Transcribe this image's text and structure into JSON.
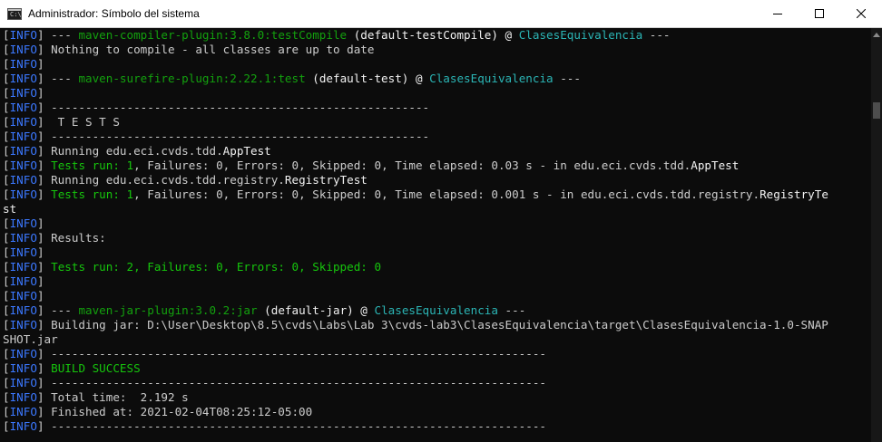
{
  "window": {
    "title": "Administrador: Símbolo del sistema",
    "icon_glyph": "C:\\"
  },
  "lines": [
    [
      {
        "t": "[",
        "c": "default"
      },
      {
        "t": "INFO",
        "c": "lvl"
      },
      {
        "t": "] --- ",
        "c": "default"
      },
      {
        "t": "maven-compiler-plugin:3.8.0:testCompile",
        "c": "plugin"
      },
      {
        "t": " (default-testCompile) @ ",
        "c": "white"
      },
      {
        "t": "ClasesEquivalencia",
        "c": "teal"
      },
      {
        "t": " ---",
        "c": "default"
      }
    ],
    [
      {
        "t": "[",
        "c": "default"
      },
      {
        "t": "INFO",
        "c": "lvl"
      },
      {
        "t": "] Nothing to compile - all classes are up to date",
        "c": "default"
      }
    ],
    [
      {
        "t": "[",
        "c": "default"
      },
      {
        "t": "INFO",
        "c": "lvl"
      },
      {
        "t": "]",
        "c": "default"
      }
    ],
    [
      {
        "t": "[",
        "c": "default"
      },
      {
        "t": "INFO",
        "c": "lvl"
      },
      {
        "t": "] --- ",
        "c": "default"
      },
      {
        "t": "maven-surefire-plugin:2.22.1:test",
        "c": "plugin"
      },
      {
        "t": " (default-test) @ ",
        "c": "white"
      },
      {
        "t": "ClasesEquivalencia",
        "c": "teal"
      },
      {
        "t": " ---",
        "c": "default"
      }
    ],
    [
      {
        "t": "[",
        "c": "default"
      },
      {
        "t": "INFO",
        "c": "lvl"
      },
      {
        "t": "]",
        "c": "default"
      }
    ],
    [
      {
        "t": "[",
        "c": "default"
      },
      {
        "t": "INFO",
        "c": "lvl"
      },
      {
        "t": "] -------------------------------------------------------",
        "c": "default"
      }
    ],
    [
      {
        "t": "[",
        "c": "default"
      },
      {
        "t": "INFO",
        "c": "lvl"
      },
      {
        "t": "]  T E S T S",
        "c": "default"
      }
    ],
    [
      {
        "t": "[",
        "c": "default"
      },
      {
        "t": "INFO",
        "c": "lvl"
      },
      {
        "t": "] -------------------------------------------------------",
        "c": "default"
      }
    ],
    [
      {
        "t": "[",
        "c": "default"
      },
      {
        "t": "INFO",
        "c": "lvl"
      },
      {
        "t": "] Running edu.eci.cvds.tdd.",
        "c": "default"
      },
      {
        "t": "AppTest",
        "c": "white"
      }
    ],
    [
      {
        "t": "[",
        "c": "default"
      },
      {
        "t": "INFO",
        "c": "lvl"
      },
      {
        "t": "] ",
        "c": "default"
      },
      {
        "t": "Tests run: ",
        "c": "green"
      },
      {
        "t": "1",
        "c": "green"
      },
      {
        "t": ", Failures: 0, Errors: 0, Skipped: 0, Time elapsed: 0.03 s - in edu.eci.cvds.tdd.",
        "c": "default"
      },
      {
        "t": "AppTest",
        "c": "white"
      }
    ],
    [
      {
        "t": "[",
        "c": "default"
      },
      {
        "t": "INFO",
        "c": "lvl"
      },
      {
        "t": "] Running edu.eci.cvds.tdd.registry.",
        "c": "default"
      },
      {
        "t": "RegistryTest",
        "c": "white"
      }
    ],
    [
      {
        "t": "[",
        "c": "default"
      },
      {
        "t": "INFO",
        "c": "lvl"
      },
      {
        "t": "] ",
        "c": "default"
      },
      {
        "t": "Tests run: ",
        "c": "green"
      },
      {
        "t": "1",
        "c": "green"
      },
      {
        "t": ", Failures: 0, Errors: 0, Skipped: 0, Time elapsed: 0.001 s - in edu.eci.cvds.tdd.registry.",
        "c": "default"
      },
      {
        "t": "RegistryTe",
        "c": "white"
      }
    ],
    [
      {
        "t": "st",
        "c": "white"
      }
    ],
    [
      {
        "t": "[",
        "c": "default"
      },
      {
        "t": "INFO",
        "c": "lvl"
      },
      {
        "t": "]",
        "c": "default"
      }
    ],
    [
      {
        "t": "[",
        "c": "default"
      },
      {
        "t": "INFO",
        "c": "lvl"
      },
      {
        "t": "] Results:",
        "c": "default"
      }
    ],
    [
      {
        "t": "[",
        "c": "default"
      },
      {
        "t": "INFO",
        "c": "lvl"
      },
      {
        "t": "]",
        "c": "default"
      }
    ],
    [
      {
        "t": "[",
        "c": "default"
      },
      {
        "t": "INFO",
        "c": "lvl"
      },
      {
        "t": "] ",
        "c": "default"
      },
      {
        "t": "Tests run: 2, Failures: 0, Errors: 0, Skipped: 0",
        "c": "green"
      }
    ],
    [
      {
        "t": "[",
        "c": "default"
      },
      {
        "t": "INFO",
        "c": "lvl"
      },
      {
        "t": "]",
        "c": "default"
      }
    ],
    [
      {
        "t": "[",
        "c": "default"
      },
      {
        "t": "INFO",
        "c": "lvl"
      },
      {
        "t": "]",
        "c": "default"
      }
    ],
    [
      {
        "t": "[",
        "c": "default"
      },
      {
        "t": "INFO",
        "c": "lvl"
      },
      {
        "t": "] --- ",
        "c": "default"
      },
      {
        "t": "maven-jar-plugin:3.0.2:jar",
        "c": "plugin"
      },
      {
        "t": " (default-jar) @ ",
        "c": "white"
      },
      {
        "t": "ClasesEquivalencia",
        "c": "teal"
      },
      {
        "t": " ---",
        "c": "default"
      }
    ],
    [
      {
        "t": "[",
        "c": "default"
      },
      {
        "t": "INFO",
        "c": "lvl"
      },
      {
        "t": "] Building jar: D:\\User\\Desktop\\8.5\\cvds\\Labs\\Lab 3\\cvds-lab3\\ClasesEquivalencia\\target\\ClasesEquivalencia-1.0-SNAP",
        "c": "default"
      }
    ],
    [
      {
        "t": "SHOT.jar",
        "c": "default"
      }
    ],
    [
      {
        "t": "[",
        "c": "default"
      },
      {
        "t": "INFO",
        "c": "lvl"
      },
      {
        "t": "] ------------------------------------------------------------------------",
        "c": "default"
      }
    ],
    [
      {
        "t": "[",
        "c": "default"
      },
      {
        "t": "INFO",
        "c": "lvl"
      },
      {
        "t": "] ",
        "c": "default"
      },
      {
        "t": "BUILD SUCCESS",
        "c": "green"
      }
    ],
    [
      {
        "t": "[",
        "c": "default"
      },
      {
        "t": "INFO",
        "c": "lvl"
      },
      {
        "t": "] ------------------------------------------------------------------------",
        "c": "default"
      }
    ],
    [
      {
        "t": "[",
        "c": "default"
      },
      {
        "t": "INFO",
        "c": "lvl"
      },
      {
        "t": "] Total time:  2.192 s",
        "c": "default"
      }
    ],
    [
      {
        "t": "[",
        "c": "default"
      },
      {
        "t": "INFO",
        "c": "lvl"
      },
      {
        "t": "] Finished at: 2021-02-04T08:25:12-05:00",
        "c": "default"
      }
    ],
    [
      {
        "t": "[",
        "c": "default"
      },
      {
        "t": "INFO",
        "c": "lvl"
      },
      {
        "t": "] ------------------------------------------------------------------------",
        "c": "default"
      }
    ]
  ],
  "colors": {
    "background": "#0c0c0c",
    "text": "#cccccc",
    "info": "#3b78ff",
    "success": "#16c60c",
    "plugin": "#13a10e",
    "project": "#2bb5b5"
  },
  "icons": {
    "minimize": "minimize-icon",
    "maximize": "maximize-icon",
    "close": "close-icon",
    "app": "console-app-icon"
  }
}
